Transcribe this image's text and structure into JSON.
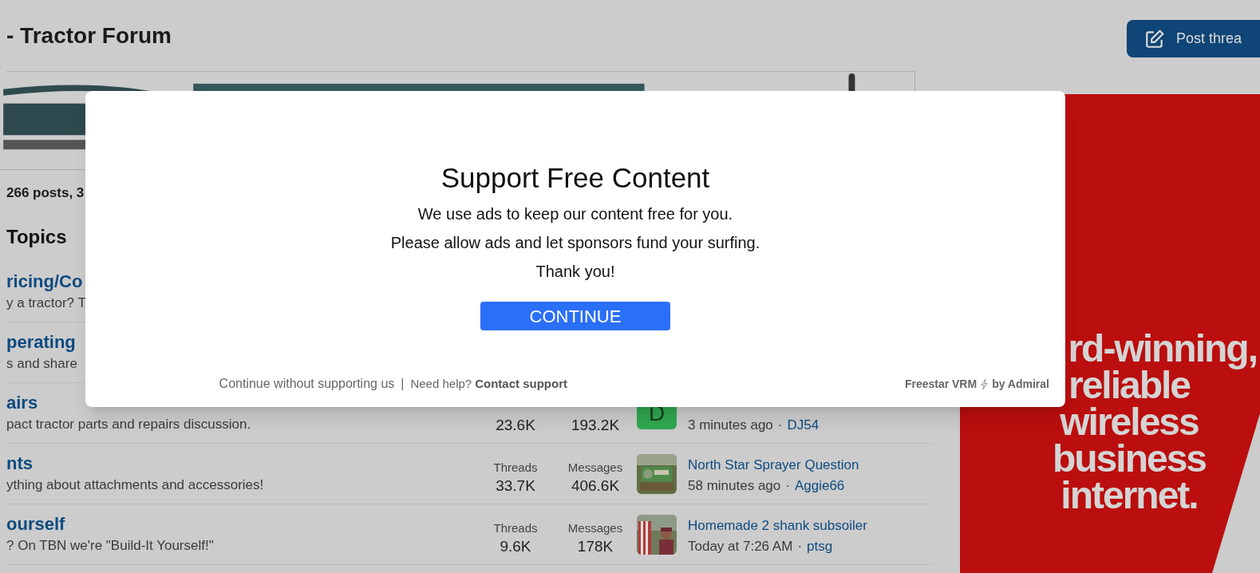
{
  "page": {
    "title": "- Tractor Forum",
    "post_button": "Post threa",
    "stats_line": "266 posts, 3",
    "section_title": "Topics"
  },
  "forums": [
    {
      "title": "ricing/Co",
      "description": "y a tractor? T"
    },
    {
      "title": "perating",
      "description": "s and share"
    },
    {
      "title": "airs",
      "description": "pact tractor parts and repairs discussion.",
      "stats": [
        {
          "value": "23.6K"
        },
        {
          "value": "193.2K"
        }
      ],
      "latest": {
        "avatar": {
          "kind": "letter",
          "letter": "D",
          "color": "#2fa84f"
        },
        "time": "3 minutes ago",
        "separator": "·",
        "user": "DJ54"
      }
    },
    {
      "title": "nts",
      "description": "ything about attachments and accessories!",
      "stats": [
        {
          "label": "Threads",
          "value": "33.7K"
        },
        {
          "label": "Messages",
          "value": "406.6K"
        }
      ],
      "latest": {
        "thread": "North Star Sprayer Question",
        "time": "58 minutes ago",
        "separator": "·",
        "user": "Aggie66"
      }
    },
    {
      "title": "ourself",
      "description": "? On TBN we're \"Build-It Yourself!\"",
      "stats": [
        {
          "label": "Threads",
          "value": "9.6K"
        },
        {
          "label": "Messages",
          "value": "178K"
        }
      ],
      "latest": {
        "thread": "Homemade 2 shank subsoiler",
        "time": "Today at 7:26 AM",
        "separator": "·",
        "user": "ptsg"
      }
    }
  ],
  "ad": {
    "lines": [
      "rd-winning,",
      "reliable",
      "wireless",
      "business",
      "internet."
    ]
  },
  "modal": {
    "title": "Support Free Content",
    "lines": [
      "We use ads to keep our content free for you.",
      "Please allow ads and let sponsors fund your surfing.",
      "Thank you!"
    ],
    "button": "CONTINUE",
    "skip_link": "Continue without supporting us",
    "separator": "|",
    "help_label": "Need help?",
    "help_link": "Contact support",
    "brand": "Freestar VRM",
    "brand_suffix": "by Admiral"
  }
}
